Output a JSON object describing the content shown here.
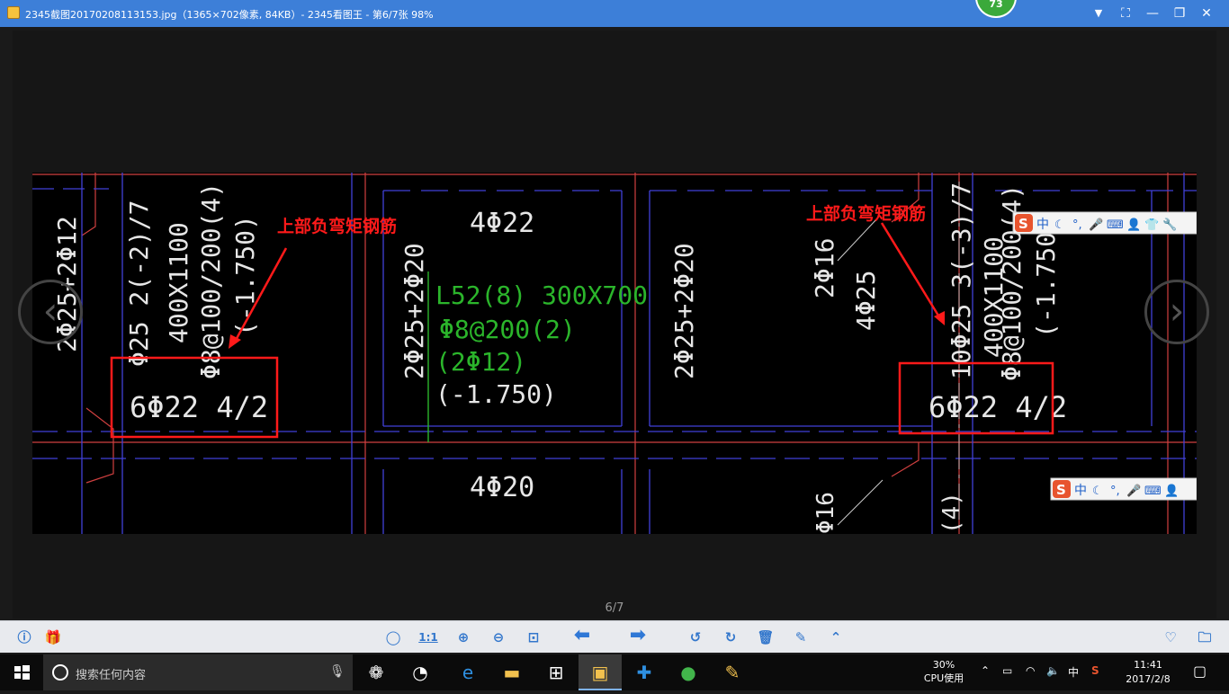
{
  "window": {
    "title": "2345截图20170208113153.jpg（1365×702像素, 84KB）- 2345看图王 - 第6/7张 98%",
    "badge": "73"
  },
  "viewer": {
    "page_counter": "6/7",
    "prev_icon": "prev-arrow-icon",
    "next_icon": "next-arrow-icon"
  },
  "drawing": {
    "annotation_left": "上部负弯矩钢筋",
    "annotation_right": "上部负弯矩钢筋",
    "labels": {
      "l_col1": "2Φ25+2Φ12",
      "l_beam1": "Φ25 2(-2)/7",
      "l_beam2": "400X1100",
      "l_beam3": "Φ8@100/200(4)",
      "l_beam4": "(-1.750)",
      "l_box": "6Φ22 4/2",
      "top_mid": "4Φ22",
      "c_col2": "2Φ25+2Φ20",
      "g1": "L52(8) 300X700",
      "g2": "Φ8@200(2)",
      "g3": "(2Φ12)",
      "g4": "(-1.750)",
      "bot_mid": "4Φ20",
      "r_col1": "2Φ25+2Φ20",
      "r_2p16": "2Φ16",
      "r_4p25": "4Φ25",
      "r_beam1": "10Φ25 3(-3)/7",
      "r_beam2": "400X1100",
      "r_beam3": "Φ8@100/200(4)",
      "r_beam4": "(-1.750)",
      "r_box": "6Φ22 4/2",
      "r_bot16": "Φ16",
      "r_bot4": "(4)"
    },
    "ime_bar_1": [
      "中",
      "☾",
      "°,",
      "🎤",
      "⌨",
      "👤",
      "👕",
      "🔧"
    ],
    "ime_bar_2": [
      "中",
      "☾",
      "°,",
      "🎤",
      "⌨",
      "👤"
    ]
  },
  "toolbar": {
    "info": "ⓘ",
    "gift": "🎁",
    "mouse": "◯",
    "actual_size": "1:1",
    "zoom_in": "⊕",
    "zoom_out": "⊖",
    "fit": "⊡",
    "prev": "⬅",
    "next": "➡",
    "rotate_left": "↺",
    "rotate_right": "↻",
    "delete": "🗑",
    "edit": "✎",
    "up": "⌃",
    "favorite": "♡",
    "folder": "🗀"
  },
  "taskbar": {
    "search_placeholder": "搜索任何内容",
    "cpu_percent": "30%",
    "cpu_label": "CPU使用",
    "ime_char": "中",
    "time": "11:41",
    "date": "2017/2/8"
  }
}
